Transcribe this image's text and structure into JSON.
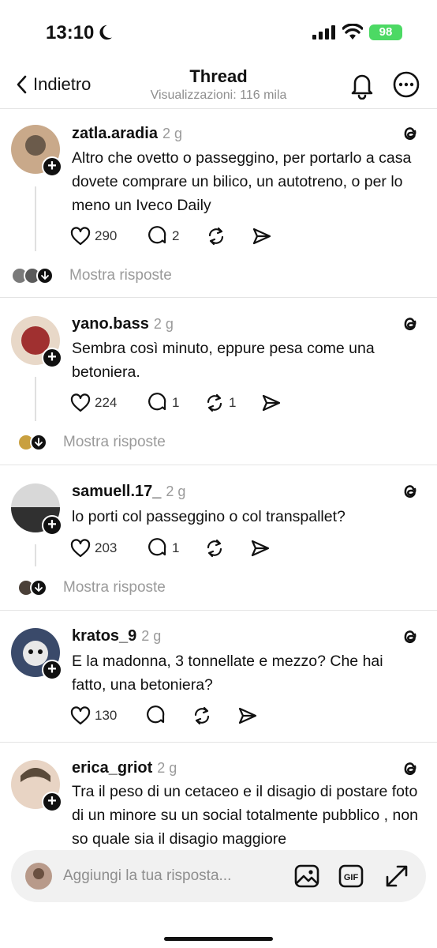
{
  "status_bar": {
    "time": "13:10",
    "battery": "98"
  },
  "nav": {
    "back_label": "Indietro",
    "title": "Thread",
    "subtitle": "Visualizzazioni: 116 mila"
  },
  "posts": [
    {
      "username": "zatla.aradia",
      "time": "2 g",
      "text": "Altro che ovetto o passeggino, per portarlo a casa dovete comprare un bilico, un autotreno, o per lo meno un Iveco Daily",
      "likes": "290",
      "comments": "2",
      "reposts": "",
      "replies_label": "Mostra risposte",
      "avatar_colors": [
        "#c9a98a",
        "#6b5b4b"
      ],
      "mini_avatar_colors": [
        "#7a7a7a",
        "#5a5a5a"
      ]
    },
    {
      "username": "yano.bass",
      "time": "2 g",
      "text": "Sembra così minuto, eppure pesa come una betoniera.",
      "likes": "224",
      "comments": "1",
      "reposts": "1",
      "replies_label": "Mostra risposte",
      "avatar_colors": [
        "#e8d8c8",
        "#a03030"
      ],
      "mini_avatar_colors": [
        "#c9a040"
      ]
    },
    {
      "username": "samuell.17_",
      "time": "2 g",
      "text": "lo porti col passeggino o col transpallet?",
      "likes": "203",
      "comments": "1",
      "reposts": "",
      "replies_label": "Mostra risposte",
      "avatar_colors": [
        "#d8d8d8",
        "#303030"
      ],
      "mini_avatar_colors": [
        "#4a4038"
      ]
    },
    {
      "username": "kratos_9",
      "time": "2 g",
      "text": "E la madonna, 3 tonnellate e mezzo? Che hai fatto, una betoniera?",
      "likes": "130",
      "comments": "",
      "reposts": "",
      "avatar_colors": [
        "#3a4a6a",
        "#e8e8e8"
      ]
    },
    {
      "username": "erica_griot",
      "time": "2 g",
      "text": "Tra il peso di un cetaceo e il disagio di postare foto di un minore su un social totalmente pubblico , non so quale sia il disagio maggiore",
      "avatar_colors": [
        "#e8d4c4",
        "#5a4a3a"
      ]
    }
  ],
  "reply_bar": {
    "placeholder": "Aggiungi la tua risposta...",
    "gif_label": "GIF",
    "avatar_color": "#b89a8a"
  },
  "colors": {
    "text": "#111111",
    "muted": "#9a9a9a",
    "divider": "#e4e4e4",
    "battery": "#4cd964"
  },
  "icons": [
    "moon-icon",
    "signal-icon",
    "wifi-icon",
    "chevron-left-icon",
    "bell-icon",
    "more-icon",
    "threads-logo-icon",
    "heart-icon",
    "comment-icon",
    "repost-icon",
    "share-icon",
    "image-icon",
    "gif-icon",
    "expand-icon"
  ]
}
